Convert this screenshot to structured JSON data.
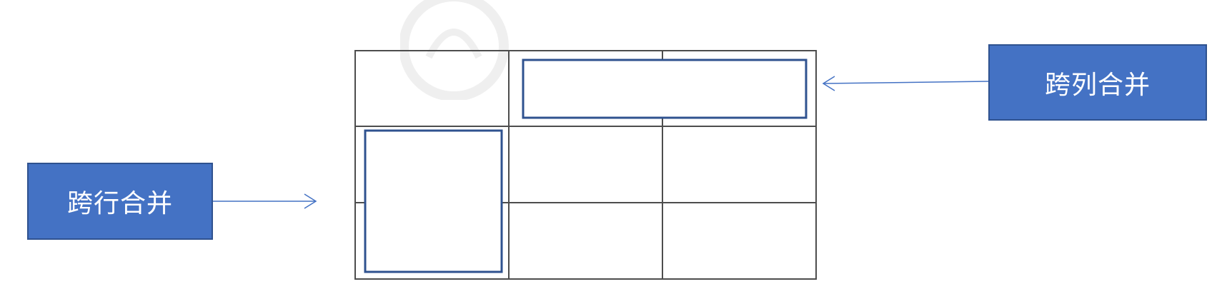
{
  "labels": {
    "rowspan": "跨行合并",
    "colspan": "跨列合并"
  },
  "colors": {
    "label_fill": "#4472c4",
    "label_border": "#2f528f",
    "highlight_border": "#2f528f",
    "grid_line": "#4d4d4d",
    "arrow": "#4472c4"
  },
  "table": {
    "rows": 3,
    "cols": 3
  }
}
